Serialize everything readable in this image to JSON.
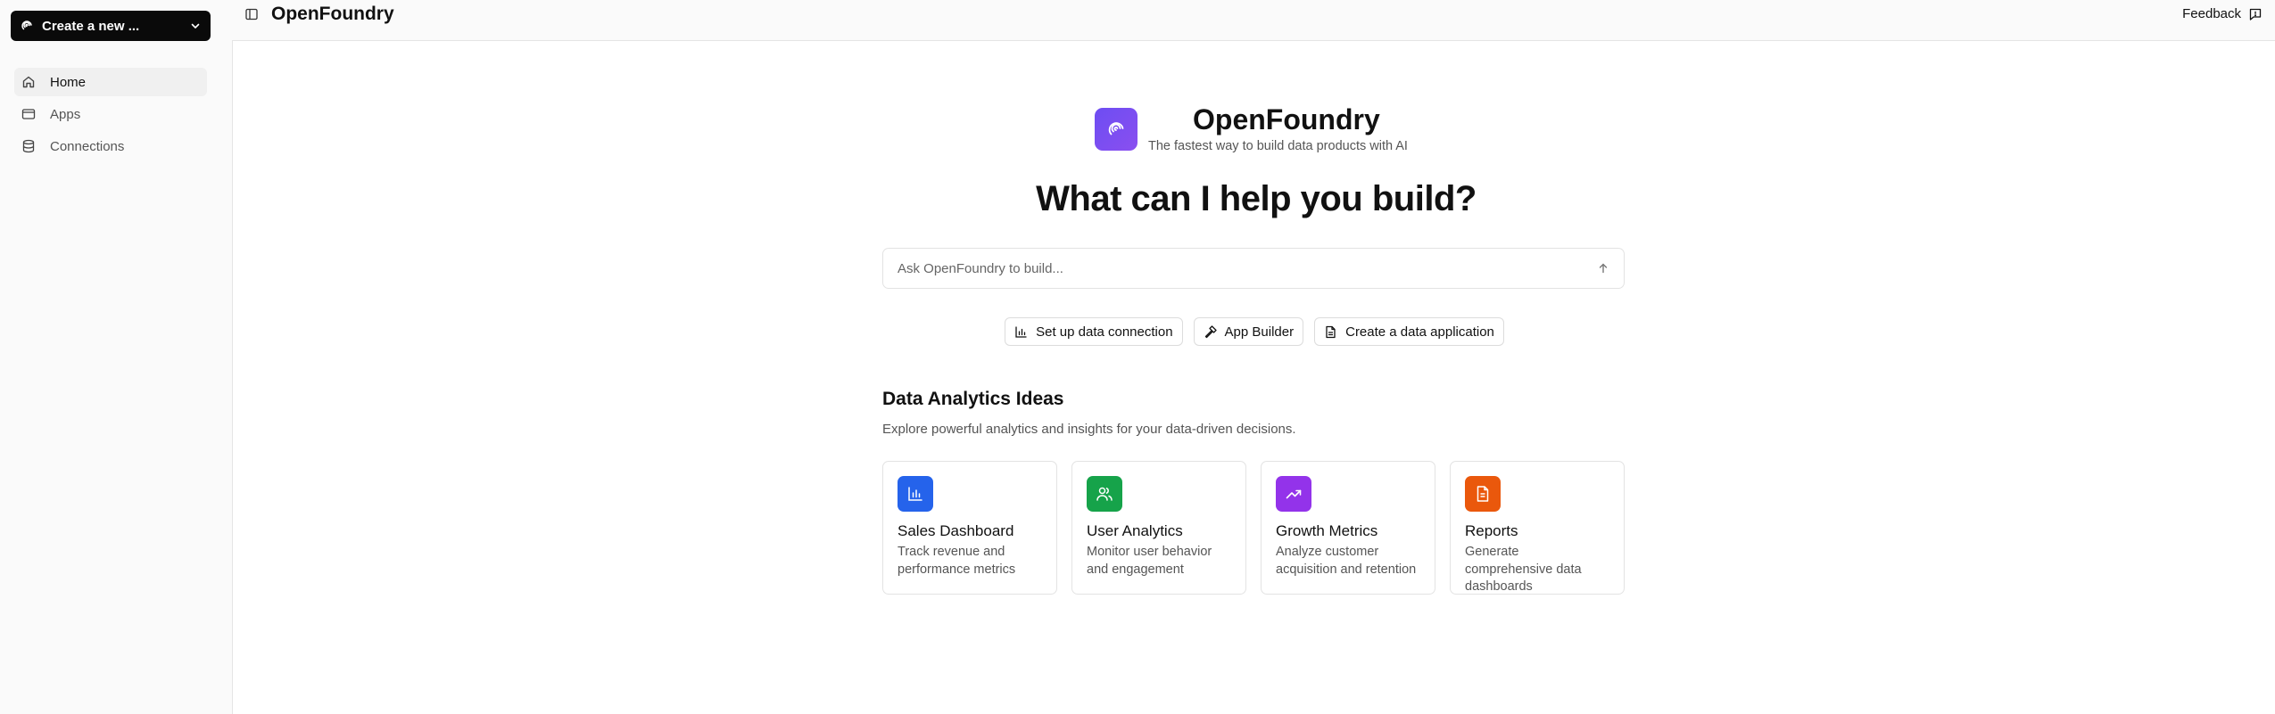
{
  "sidebar": {
    "create_label": "Create a new ...",
    "items": [
      {
        "label": "Home",
        "icon": "home-icon",
        "active": true
      },
      {
        "label": "Apps",
        "icon": "window-icon",
        "active": false
      },
      {
        "label": "Connections",
        "icon": "database-icon",
        "active": false
      }
    ]
  },
  "header": {
    "title": "OpenFoundry",
    "feedback_label": "Feedback"
  },
  "hero": {
    "brand_name": "OpenFoundry",
    "tagline": "The fastest way to build data products with AI",
    "headline": "What can I help you build?",
    "input_placeholder": "Ask OpenFoundry to build...",
    "input_value": ""
  },
  "quick_actions": [
    {
      "label": "Set up data connection",
      "icon": "bar-chart-icon"
    },
    {
      "label": "App Builder",
      "icon": "hammer-icon"
    },
    {
      "label": "Create a data application",
      "icon": "file-icon"
    }
  ],
  "ideas": {
    "title": "Data Analytics Ideas",
    "subtitle": "Explore powerful analytics and insights for your data-driven decisions.",
    "cards": [
      {
        "title": "Sales Dashboard",
        "desc": "Track revenue and performance metrics",
        "icon": "bar-chart-icon",
        "color": "#2563eb"
      },
      {
        "title": "User Analytics",
        "desc": "Monitor user behavior and engagement",
        "icon": "users-icon",
        "color": "#16a34a"
      },
      {
        "title": "Growth Metrics",
        "desc": "Analyze customer acquisition and retention",
        "icon": "trending-up-icon",
        "color": "#9333ea"
      },
      {
        "title": "Reports",
        "desc": "Generate comprehensive data dashboards",
        "icon": "document-icon",
        "color": "#ea580c"
      }
    ]
  },
  "colors": {
    "brand_gradient_start": "#6d4df2",
    "brand_gradient_end": "#8a4ff0",
    "primary_button": "#0a0a0a"
  }
}
